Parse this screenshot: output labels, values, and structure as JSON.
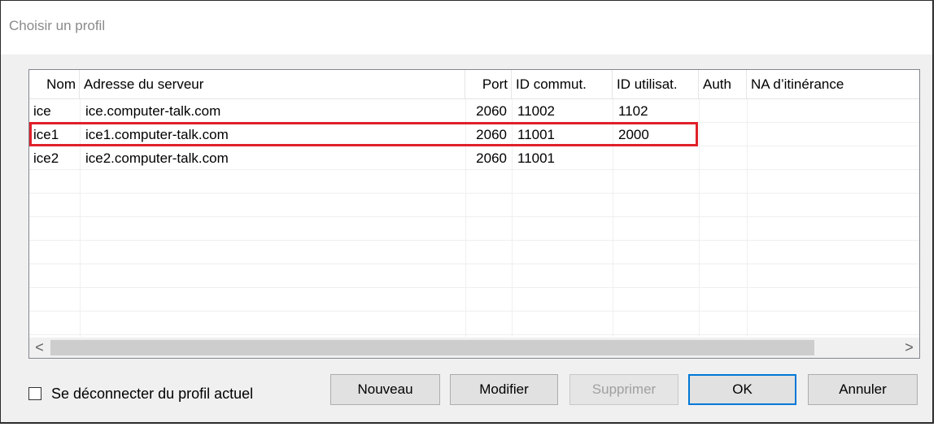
{
  "dialog": {
    "title": "Choisir un profil"
  },
  "table": {
    "columns": [
      "Nom",
      "Adresse du serveur",
      "Port",
      "ID commut.",
      "ID utilisat.",
      "Auth",
      "NA d’itinérance"
    ],
    "rows": [
      {
        "nom": "ice",
        "adresse": "ice.computer-talk.com",
        "port": "2060",
        "id_commut": "11002",
        "id_utilisat": "1102",
        "auth": "",
        "na": ""
      },
      {
        "nom": "ice1",
        "adresse": "ice1.computer-talk.com",
        "port": "2060",
        "id_commut": "11001",
        "id_utilisat": "2000",
        "auth": "",
        "na": ""
      },
      {
        "nom": "ice2",
        "adresse": "ice2.computer-talk.com",
        "port": "2060",
        "id_commut": "11001",
        "id_utilisat": "",
        "auth": "",
        "na": ""
      }
    ],
    "highlighted_row": "ice1",
    "highlight_color": "#e0202a"
  },
  "scrollbar": {
    "left_icon": "chevron-left-icon",
    "right_icon": "chevron-right-icon",
    "left_glyph": "<",
    "right_glyph": ">"
  },
  "checkbox": {
    "label": "Se déconnecter du profil actuel",
    "checked": false
  },
  "buttons": {
    "new": "Nouveau",
    "edit": "Modifier",
    "delete": "Supprimer",
    "ok": "OK",
    "cancel": "Annuler"
  }
}
